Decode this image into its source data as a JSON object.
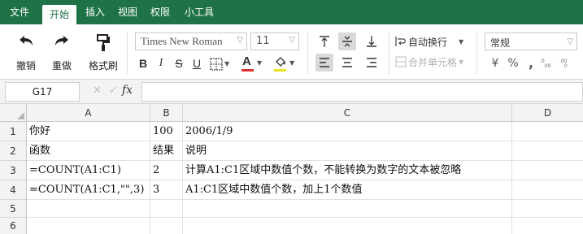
{
  "menu": {
    "items": [
      "文件",
      "开始",
      "插入",
      "视图",
      "权限",
      "小工具"
    ],
    "active": "开始"
  },
  "ribbon": {
    "undo_label": "撤销",
    "redo_label": "重做",
    "format_painter_label": "格式刷",
    "font_name": "Times New Roman",
    "font_size": "11",
    "bold": "B",
    "italic": "I",
    "strikethrough": "S",
    "underline": "U",
    "wrap_text_label": "自动换行",
    "merge_label": "合并单元格",
    "number_format": "常规",
    "font_color": "#e03030",
    "fill_color": "#f0e020"
  },
  "formula_bar": {
    "name_box": "G17",
    "cancel": "✕",
    "confirm": "✓",
    "fx": "fx",
    "content": ""
  },
  "sheet": {
    "columns": [
      "A",
      "B",
      "C",
      "D"
    ],
    "rows": [
      {
        "num": "1",
        "cells": [
          "你好",
          "100",
          "2006/1/9",
          ""
        ]
      },
      {
        "num": "2",
        "cells": [
          "函数",
          "结果",
          "说明",
          ""
        ]
      },
      {
        "num": "3",
        "cells": [
          "=COUNT(A1:C1)",
          "2",
          "计算A1:C1区域中数值个数，不能转换为数字的文本被忽略",
          ""
        ]
      },
      {
        "num": "4",
        "cells": [
          "=COUNT(A1:C1,\"\",3)",
          "3",
          "A1:C1区域中数值个数，加上1个数值",
          ""
        ]
      },
      {
        "num": "5",
        "cells": [
          "",
          "",
          "",
          ""
        ]
      },
      {
        "num": "6",
        "cells": [
          "",
          "",
          "",
          ""
        ]
      }
    ]
  }
}
